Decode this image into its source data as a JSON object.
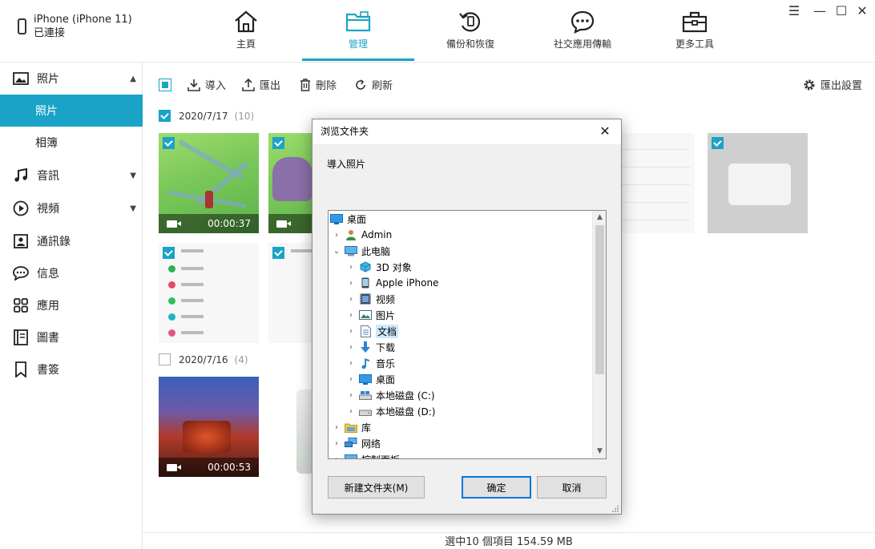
{
  "device": {
    "name": "iPhone (iPhone 11)",
    "status": "已連接"
  },
  "nav": {
    "tabs": [
      {
        "label": "主頁",
        "icon": "home-icon"
      },
      {
        "label": "管理",
        "icon": "folder-icon"
      },
      {
        "label": "備份和恢復",
        "icon": "backup-icon"
      },
      {
        "label": "社交應用傳輸",
        "icon": "chat-icon"
      },
      {
        "label": "更多工具",
        "icon": "toolbox-icon"
      }
    ],
    "active_tab": "管理"
  },
  "window": {
    "menu": "☰",
    "minimize": "—",
    "maximize": "☐",
    "close": "✕"
  },
  "sidebar": {
    "photos": "照片",
    "photos_sub": "照片",
    "albums": "相簿",
    "audio": "音訊",
    "video": "視頻",
    "contacts": "通訊錄",
    "messages": "信息",
    "apps": "應用",
    "books": "圖書",
    "bookmarks": "書簽"
  },
  "toolbar": {
    "import": "導入",
    "export": "匯出",
    "delete": "刪除",
    "refresh": "刷新",
    "export_settings": "匯出設置"
  },
  "groups": [
    {
      "date": "2020/7/17",
      "count": "(10)"
    },
    {
      "date": "2020/7/16",
      "count": "(4)"
    }
  ],
  "videos": {
    "v1": "00:00:37",
    "v2": "00:00:53"
  },
  "footer": {
    "status": "選中10 個項目 154.59 MB"
  },
  "dialog": {
    "title": "浏览文件夹",
    "description": "導入照片",
    "tree": [
      {
        "label": "桌面",
        "icon": "desktop-icon"
      },
      {
        "label": "Admin",
        "icon": "user-icon"
      },
      {
        "label": "此电脑",
        "icon": "computer-icon"
      },
      {
        "label": "3D 对象",
        "icon": "3d-objects-icon"
      },
      {
        "label": "Apple iPhone",
        "icon": "phone-icon"
      },
      {
        "label": "视频",
        "icon": "video-folder-icon"
      },
      {
        "label": "图片",
        "icon": "pictures-folder-icon"
      },
      {
        "label": "文档",
        "icon": "documents-folder-icon"
      },
      {
        "label": "下载",
        "icon": "download-icon"
      },
      {
        "label": "音乐",
        "icon": "music-icon"
      },
      {
        "label": "桌面",
        "icon": "desktop-icon"
      },
      {
        "label": "本地磁盘 (C:)",
        "icon": "drive-icon"
      },
      {
        "label": "本地磁盘 (D:)",
        "icon": "drive-icon"
      },
      {
        "label": "库",
        "icon": "library-icon"
      },
      {
        "label": "网络",
        "icon": "network-icon"
      },
      {
        "label": "控制面板",
        "icon": "control-panel-icon"
      }
    ],
    "selected": "文档",
    "new_folder": "新建文件夹(M)",
    "ok": "确定",
    "cancel": "取消"
  },
  "colors": {
    "accent": "#19a3c6",
    "selection": "#cce8ff",
    "dialog_primary": "#0078d7"
  }
}
